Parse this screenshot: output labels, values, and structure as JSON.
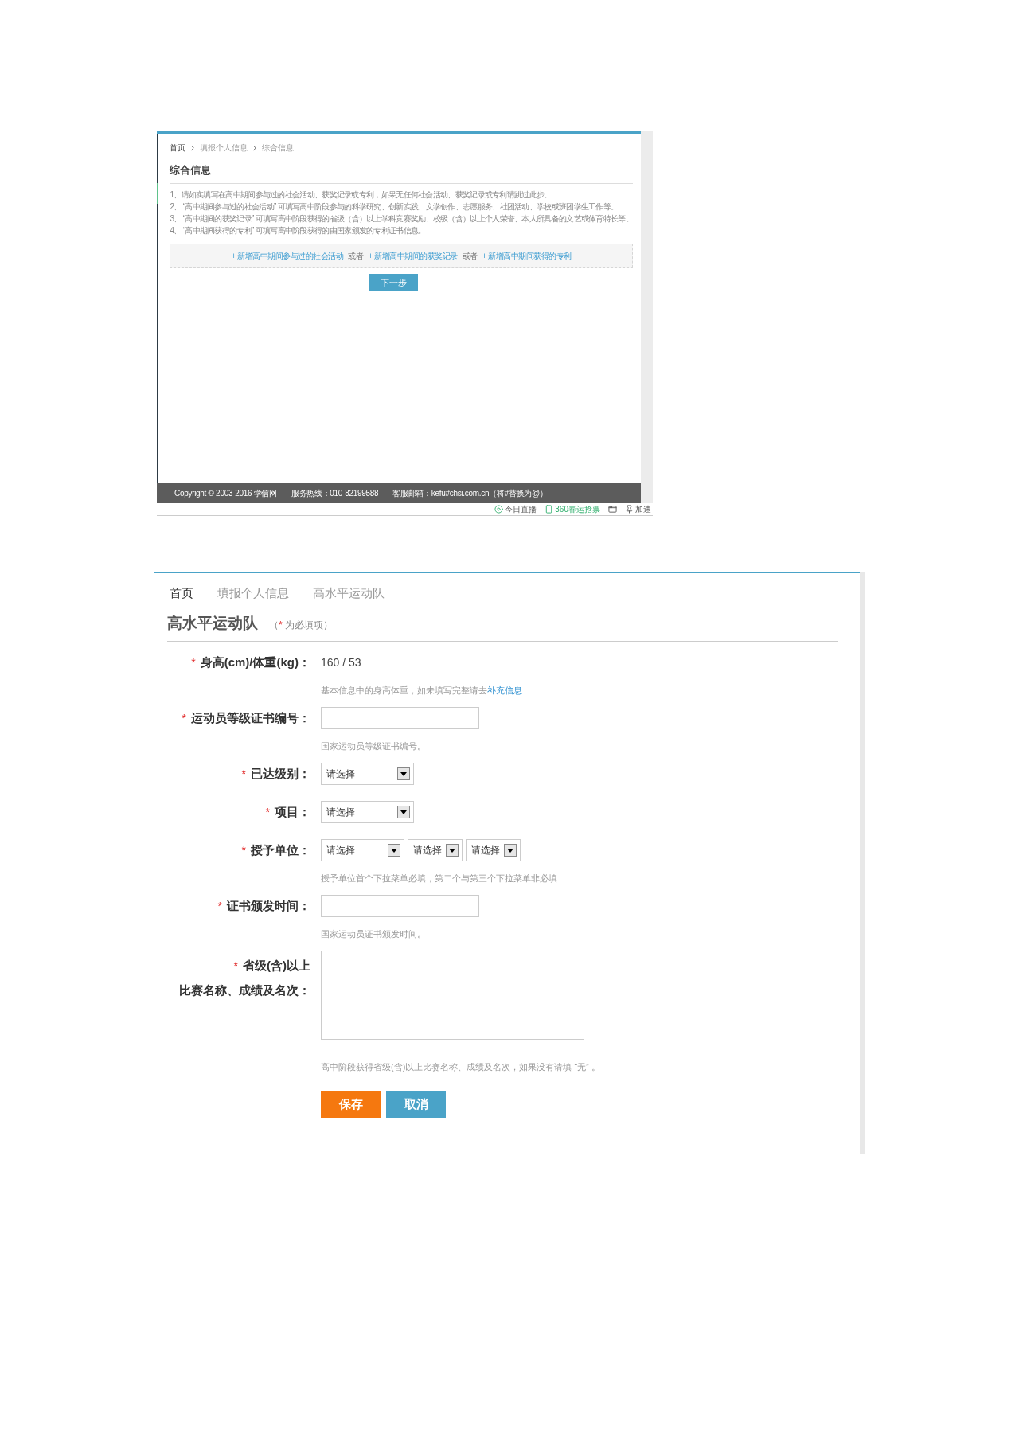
{
  "summary_page": {
    "breadcrumb": [
      {
        "text": "首页",
        "kind": "link"
      },
      {
        "text": "填报个人信息",
        "kind": "plain"
      },
      {
        "text": "综合信息",
        "kind": "plain"
      }
    ],
    "title": "综合信息",
    "instructions": [
      "1、请如实填写在高中期间参与过的社会活动、获奖记录或专利，如果无任何社会活动、获奖记录或专利请跳过此步。",
      "2、 “高中期间参与过的社会活动” 可填写高中阶段参与的科学研究、创新实践、文学创作、志愿服务、社团活动、学校或班团学生工作等。",
      "3、 “高中期间的获奖记录” 可填写高中阶段获得的省级（含）以上学科竞赛奖励、校级（含）以上个人荣誉、本人所具备的文艺或体育特长等。",
      "4、 “高中期间获得的专利” 可填写高中阶段获得的由国家颁发的专利证书信息。"
    ],
    "add_links": [
      {
        "kind": "link",
        "text": "+ 新增高中期间参与过的社会活动"
      },
      {
        "kind": "text",
        "text": "或者"
      },
      {
        "kind": "link",
        "text": "+ 新增高中期间的获奖记录"
      },
      {
        "kind": "text",
        "text": "或者"
      },
      {
        "kind": "link",
        "text": "+ 新增高中期间获得的专利"
      }
    ],
    "next_button": "下一步",
    "footer": [
      "Copyright © 2003-2016 学信网",
      "服务热线：010-82199588",
      "客服邮箱：kefu#chsi.com.cn（将#替换为@）"
    ],
    "status_bar": [
      {
        "kind": "play",
        "text": "今日直播"
      },
      {
        "kind": "phone",
        "text": "360春运抢票"
      },
      {
        "kind": "window"
      },
      {
        "kind": "pin",
        "text": "加速"
      }
    ]
  },
  "form_page": {
    "breadcrumb": [
      {
        "text": "首页",
        "kind": "link"
      },
      {
        "text": "填报个人信息",
        "kind": "plain"
      },
      {
        "text": "高水平运动队",
        "kind": "plain"
      }
    ],
    "title": "高水平运动队",
    "note": {
      "open": "（",
      "mark": "*",
      "text": "为必填项）"
    },
    "fields": [
      {
        "kind": "static",
        "mark": "*",
        "label": [
          "身高(cm)/体重(kg)："
        ],
        "value": "160 / 53",
        "hint": "基本信息中的身高体重，如未填写完整请去",
        "hint_link": "补充信息"
      },
      {
        "kind": "input",
        "mark": "*",
        "label": [
          "运动员等级证书编号："
        ],
        "hint": "国家运动员等级证书编号。"
      },
      {
        "kind": "select",
        "mark": "*",
        "label": [
          "已达级别："
        ],
        "selects": [
          "请选择"
        ]
      },
      {
        "kind": "select",
        "mark": "*",
        "label": [
          "项目："
        ],
        "selects": [
          "请选择"
        ]
      },
      {
        "kind": "select",
        "mark": "*",
        "label": [
          "授予单位："
        ],
        "selects": [
          "请选择",
          "请选择",
          "请选择"
        ],
        "hint": "授予单位首个下拉菜单必填，第二个与第三个下拉菜单非必填"
      },
      {
        "kind": "input",
        "mark": "*",
        "label": [
          "证书颁发时间："
        ],
        "hint": "国家运动员证书颁发时间。"
      },
      {
        "kind": "textarea",
        "mark": "*",
        "label": [
          "省级(含)以上",
          "比赛名称、成绩及名次："
        ],
        "hint": "高中阶段获得省级(含)以上比赛名称、成绩及名次，如果没有请填 “无” 。"
      }
    ],
    "buttons": [
      {
        "kind": "primary",
        "label": "保存"
      },
      {
        "kind": "secondary",
        "label": "取消"
      }
    ]
  }
}
